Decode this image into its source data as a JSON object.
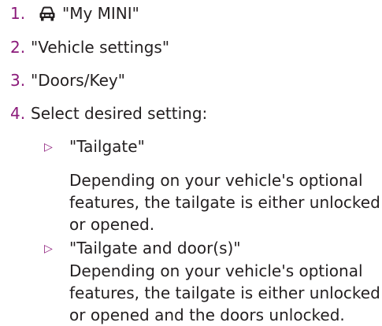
{
  "colors": {
    "accent": "#8b1a7a",
    "text": "#231f20"
  },
  "steps": [
    {
      "number": "1.",
      "icon": "car-icon",
      "text": "\"My MINI\""
    },
    {
      "number": "2.",
      "text": "\"Vehicle settings\""
    },
    {
      "number": "3.",
      "text": "\"Doors/Key\""
    },
    {
      "number": "4.",
      "text": "Select desired setting:"
    }
  ],
  "options": [
    {
      "bullet": "▷",
      "label": "\"Tailgate\"",
      "description": "Depending on your vehicle's optional features, the tailgate is either unlocked or opened."
    },
    {
      "bullet": "▷",
      "label": "\"Tailgate and door(s)\"",
      "description": "Depending on your vehicle's optional features, the tailgate is either unlocked or opened and the doors unlocked."
    }
  ]
}
